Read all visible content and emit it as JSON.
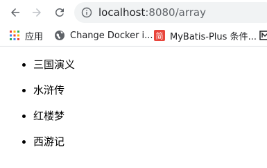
{
  "window": {
    "url_host": "localhost",
    "url_rest": ":8080/array"
  },
  "bookmarks": [
    {
      "label": "应用",
      "icon": "apps-grid-icon"
    },
    {
      "label": "Change Docker i...",
      "icon": "globe-icon"
    },
    {
      "label": "MyBatis-Plus 条件...",
      "icon": "jian-icon",
      "badge": "简"
    }
  ],
  "main": {
    "items": [
      "三国演义",
      "水浒传",
      "红楼梦",
      "西游记"
    ]
  },
  "colors": {
    "omnibox_bg": "#f1f3f4",
    "jian_badge_bg": "#e8453c",
    "icon_gray": "#5f6368",
    "icon_disabled": "#bdc1c6"
  }
}
